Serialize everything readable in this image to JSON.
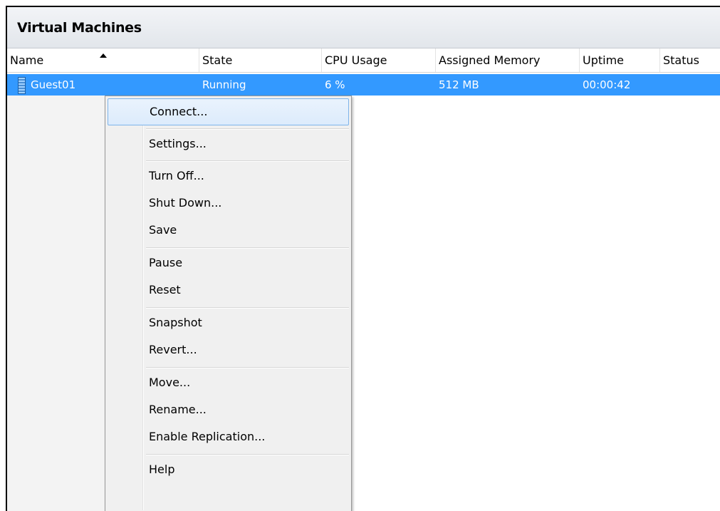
{
  "panel": {
    "title": "Virtual Machines"
  },
  "columns": [
    "Name",
    "State",
    "CPU Usage",
    "Assigned Memory",
    "Uptime",
    "Status"
  ],
  "sort": {
    "column": "Name",
    "direction": "ascending"
  },
  "vms": [
    {
      "name": "Guest01",
      "state": "Running",
      "cpu": "6 %",
      "memory": "512 MB",
      "uptime": "00:00:42",
      "status": "",
      "selected": true
    }
  ],
  "context_menu": {
    "items": [
      {
        "label": "Connect...",
        "highlighted": true
      },
      {
        "label": "Settings..."
      },
      {
        "label": "Turn Off..."
      },
      {
        "label": "Shut Down..."
      },
      {
        "label": "Save"
      },
      {
        "label": "Pause"
      },
      {
        "label": "Reset"
      },
      {
        "label": "Snapshot"
      },
      {
        "label": "Revert..."
      },
      {
        "label": "Move..."
      },
      {
        "label": "Rename..."
      },
      {
        "label": "Enable Replication..."
      },
      {
        "label": "Help"
      }
    ]
  },
  "icons": {
    "vm": "virtual-machine-icon",
    "sort": "sort-ascending-icon"
  },
  "colors": {
    "selection": "#3399ff",
    "menu_highlight_border": "#7eb4ea",
    "menu_background": "#f0f0f0"
  }
}
